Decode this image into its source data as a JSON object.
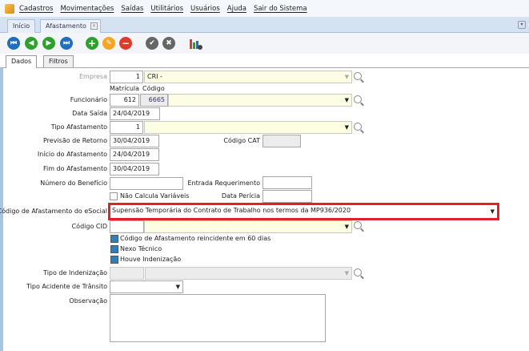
{
  "menu": [
    "Cadastros",
    "Movimentações",
    "Saídas",
    "Utilitários",
    "Usuários",
    "Ajuda",
    "Sair do Sistema"
  ],
  "doc_tabs": {
    "inicio": "Início",
    "afastamento": "Afastamento"
  },
  "inner_tabs": {
    "dados": "Dados",
    "filtros": "Filtros"
  },
  "form": {
    "empresa": {
      "label": "Empresa",
      "code": "1",
      "name": "CRI -"
    },
    "matricula_label": "Matrícula",
    "codigo_label": "Código",
    "funcionario": {
      "label": "Funcionário",
      "matricula": "612",
      "codigo": "6665",
      "name": ""
    },
    "data_saida": {
      "label": "Data Saída",
      "value": "24/04/2019"
    },
    "tipo_afastamento": {
      "label": "Tipo Afastamento",
      "code": "1",
      "name": ""
    },
    "previsao_retorno": {
      "label": "Previsão de Retorno",
      "value": "30/04/2019"
    },
    "codigo_cat": {
      "label": "Código CAT",
      "value": ""
    },
    "inicio_afastamento": {
      "label": "Início do Afastamento",
      "value": "24/04/2019"
    },
    "fim_afastamento": {
      "label": "Fim do Afastamento",
      "value": "30/04/2019"
    },
    "numero_beneficio": {
      "label": "Número do Benefício",
      "value": ""
    },
    "entrada_requerimento": {
      "label": "Entrada Requerimento",
      "value": ""
    },
    "nao_calcula": {
      "label": "Não Calcula Variáveis",
      "checked": false
    },
    "data_pericia": {
      "label": "Data Perícia",
      "value": ""
    },
    "codigo_esocial": {
      "label": "Código de Afastamento do eSocial",
      "value": "Supensão Temporária do Contrato de Trabalho nos termos da MP936/2020"
    },
    "codigo_cid": {
      "label": "Código CID",
      "value": ""
    },
    "reincidente": {
      "label": "Código de Afastamento reincidente em 60 dias",
      "checked": true
    },
    "nexo": {
      "label": "Nexo Técnico",
      "checked": true
    },
    "indenizacao": {
      "label": "Houve Indenização",
      "checked": true
    },
    "tipo_indenizacao": {
      "label": "Tipo de Indenização",
      "value": ""
    },
    "tipo_acidente": {
      "label": "Tipo Acidente de Trânsito",
      "value": ""
    },
    "observacao": {
      "label": "Observação",
      "value": ""
    }
  },
  "colors": {
    "highlight": "#e0202a",
    "field_yellow": "#fdfde4",
    "nav_blue": "#1f6fc0",
    "add_green": "#2ea02e",
    "edit_orange": "#f5a623",
    "delete_red": "#e23a2a",
    "gray_btn": "#666666"
  }
}
